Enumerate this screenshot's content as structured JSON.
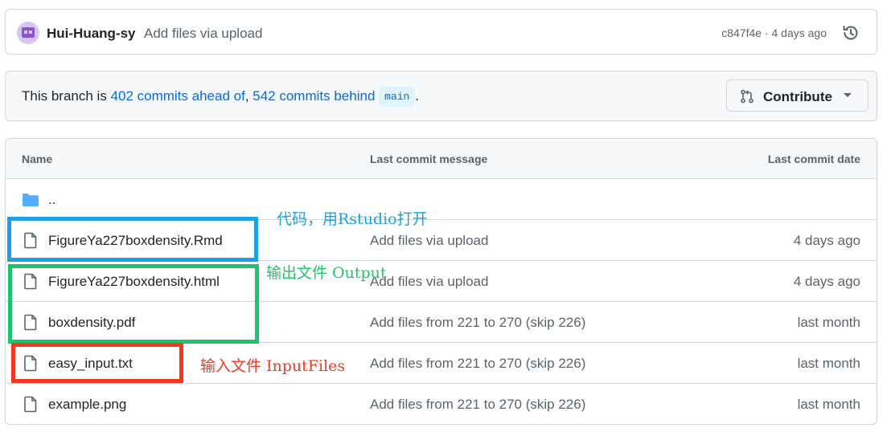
{
  "commit": {
    "author": "Hui-Huang-sy",
    "message": "Add files via upload",
    "meta": "c847f4e · 4 days ago"
  },
  "branch": {
    "prefix": "This branch is ",
    "ahead": "402 commits ahead of",
    "separator": ", ",
    "behind": "542 commits behind",
    "base": "main",
    "suffix": ".",
    "contribute_label": "Contribute"
  },
  "table": {
    "headers": {
      "name": "Name",
      "message": "Last commit message",
      "date": "Last commit date"
    },
    "parent": "..",
    "rows": [
      {
        "name": "FigureYa227boxdensity.Rmd",
        "message": "Add files via upload",
        "date": "4 days ago"
      },
      {
        "name": "FigureYa227boxdensity.html",
        "message": "Add files via upload",
        "date": "4 days ago"
      },
      {
        "name": "boxdensity.pdf",
        "message": "Add files from 221 to 270 (skip 226)",
        "date": "last month"
      },
      {
        "name": "easy_input.txt",
        "message": "Add files from 221 to 270 (skip 226)",
        "date": "last month"
      },
      {
        "name": "example.png",
        "message": "Add files from 221 to 270 (skip 226)",
        "date": "last month"
      }
    ]
  },
  "annotations": {
    "code": {
      "text": "代码，用Rstudio打开",
      "color": "#1e9fe6"
    },
    "output": {
      "text": "输出文件 Output",
      "color": "#1fc46a"
    },
    "input": {
      "text": "输入文件 InputFiles",
      "color": "#f0391f"
    }
  },
  "colors": {
    "link": "#0969da",
    "folder": "#54aeff",
    "border": "#d0d7de"
  }
}
